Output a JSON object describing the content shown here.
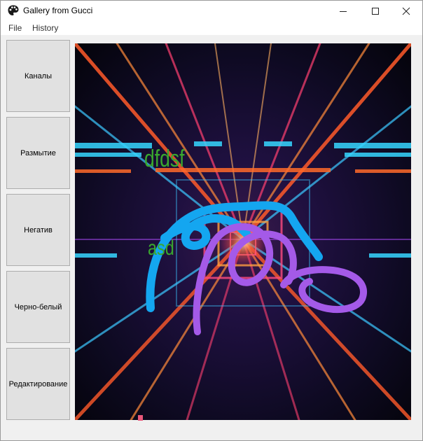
{
  "window": {
    "title": "Gallery from Gucci",
    "app_icon": "palette-icon",
    "controls": [
      "minimize-icon",
      "maximize-icon",
      "close-icon"
    ]
  },
  "menubar": {
    "file_label": "File",
    "history_label": "History"
  },
  "sidebar": {
    "items": [
      {
        "label": "Каналы"
      },
      {
        "label": "Размытие"
      },
      {
        "label": "Негатив"
      },
      {
        "label": "Черно-белый"
      },
      {
        "label": "Редактирование"
      }
    ]
  },
  "canvas": {
    "annotations": [
      "dfdsf",
      "asd"
    ],
    "colors": {
      "text": "#3aa82e",
      "stroke_blue": "#14a6f0",
      "stroke_purple": "#a45ae8"
    }
  }
}
